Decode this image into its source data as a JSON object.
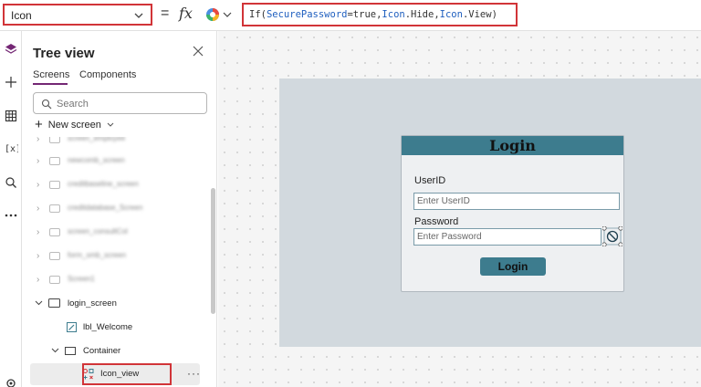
{
  "formula_bar": {
    "property": "Icon",
    "equals": "=",
    "fx": "fx",
    "formula": {
      "fn": "If(",
      "arg1": "SecurePassword",
      "op": "=true,",
      "arg2": "Icon",
      "dot1": ".Hide,",
      "arg3": "Icon",
      "dot2": ".View",
      "close": ")"
    }
  },
  "tree": {
    "title": "Tree view",
    "tabs": [
      "Screens",
      "Components"
    ],
    "search_placeholder": "Search",
    "new_screen": "New screen",
    "blurred_items": [
      "screen_employee",
      "newcomb_screen",
      "creditbaseline_screen",
      "creditdatabase_Screen",
      "screen_consultCol",
      "form_smb_screen",
      "Screen1"
    ],
    "items": {
      "login_screen": "login_screen",
      "lbl_welcome": "lbl_Welcome",
      "container": "Container",
      "icon_view": "Icon_view"
    },
    "more": "···"
  },
  "login_form": {
    "title": "Login",
    "userid_label": "UserID",
    "userid_placeholder": "Enter UserID",
    "password_label": "Password",
    "password_placeholder": "Enter Password",
    "login_button": "Login"
  },
  "colors": {
    "accent": "#742774",
    "header": "#3d7c8e",
    "highlight_box": "#d13438",
    "keyword": "#1f5fbf"
  }
}
